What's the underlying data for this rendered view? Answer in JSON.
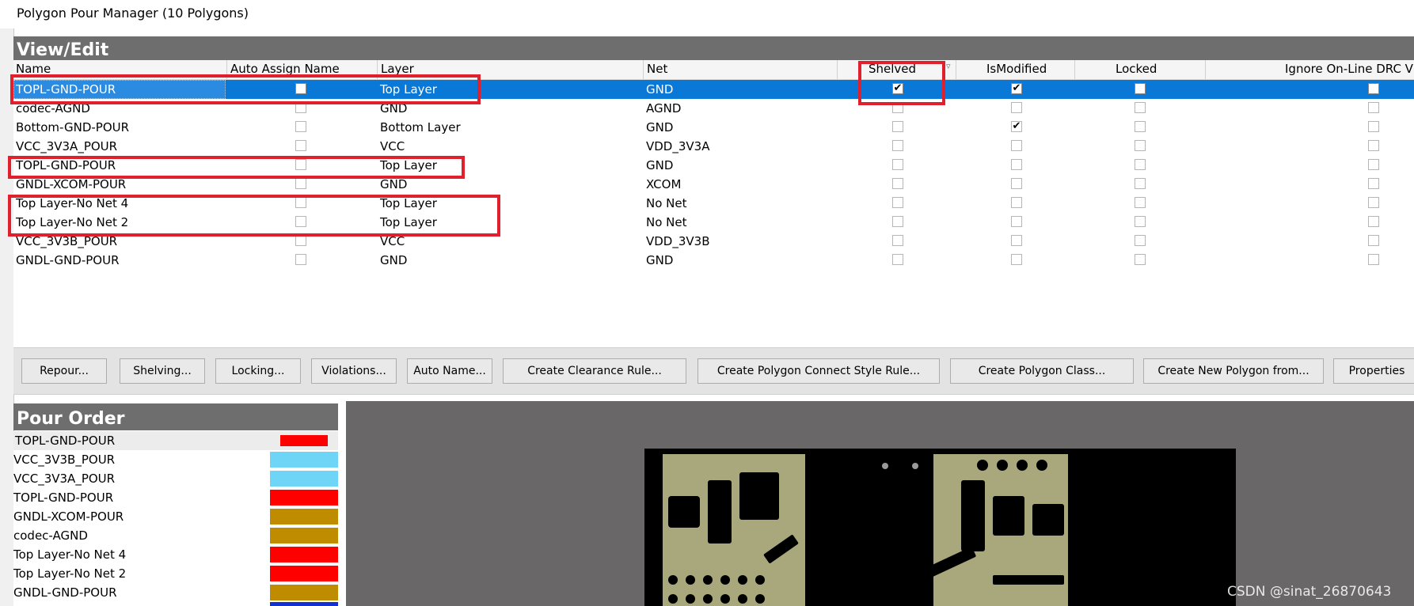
{
  "window": {
    "title": "Polygon Pour Manager (10 Polygons)"
  },
  "view_edit": {
    "section_title": "View/Edit",
    "columns": [
      "Name",
      "Auto Assign Name",
      "Layer",
      "Net",
      "Shelved",
      "IsModified",
      "Locked",
      "Ignore On-Line DRC Vio"
    ],
    "rows": [
      {
        "name": "TOPL-GND-POUR",
        "layer": "Top Layer",
        "net": "GND",
        "shelved": true,
        "modified": true,
        "selected": true
      },
      {
        "name": "codec-AGND",
        "layer": "GND",
        "net": "AGND",
        "shelved": false,
        "modified": false
      },
      {
        "name": "Bottom-GND-POUR",
        "layer": "Bottom Layer",
        "net": "GND",
        "shelved": false,
        "modified": true
      },
      {
        "name": "VCC_3V3A_POUR",
        "layer": "VCC",
        "net": "VDD_3V3A",
        "shelved": false,
        "modified": false
      },
      {
        "name": "TOPL-GND-POUR",
        "layer": "Top Layer",
        "net": "GND",
        "shelved": false,
        "modified": false
      },
      {
        "name": "GNDL-XCOM-POUR",
        "layer": "GND",
        "net": "XCOM",
        "shelved": false,
        "modified": false
      },
      {
        "name": "Top Layer-No Net 4",
        "layer": "Top Layer",
        "net": "No Net",
        "shelved": false,
        "modified": false
      },
      {
        "name": "Top Layer-No Net 2",
        "layer": "Top Layer",
        "net": "No Net",
        "shelved": false,
        "modified": false
      },
      {
        "name": "VCC_3V3B_POUR",
        "layer": "VCC",
        "net": "VDD_3V3B",
        "shelved": false,
        "modified": false
      },
      {
        "name": "GNDL-GND-POUR",
        "layer": "GND",
        "net": "GND",
        "shelved": false,
        "modified": false
      }
    ]
  },
  "buttons": [
    "Repour...",
    "Shelving...",
    "Locking...",
    "Violations...",
    "Auto Name...",
    "Create Clearance Rule...",
    "Create Polygon Connect Style Rule...",
    "Create Polygon Class...",
    "Create New Polygon from...",
    "Properties"
  ],
  "pour_order": {
    "section_title": "Pour Order",
    "items": [
      {
        "name": "TOPL-GND-POUR",
        "color": "#ff0000",
        "selected": true
      },
      {
        "name": "VCC_3V3B_POUR",
        "color": "#6fd5f7"
      },
      {
        "name": "VCC_3V3A_POUR",
        "color": "#6fd5f7"
      },
      {
        "name": "TOPL-GND-POUR",
        "color": "#ff0000"
      },
      {
        "name": "GNDL-XCOM-POUR",
        "color": "#bf8c00"
      },
      {
        "name": "codec-AGND",
        "color": "#bf8c00"
      },
      {
        "name": "Top Layer-No Net 4",
        "color": "#ff0000"
      },
      {
        "name": "Top Layer-No Net 2",
        "color": "#ff0000"
      },
      {
        "name": "GNDL-GND-POUR",
        "color": "#bf8c00"
      }
    ]
  },
  "watermark": "CSDN @sinat_26870643",
  "colors": {
    "selection": "#0a78d7",
    "section_bar": "#6e6e6e",
    "highlight_box": "#e0202c",
    "copper": "#a9a87c"
  }
}
